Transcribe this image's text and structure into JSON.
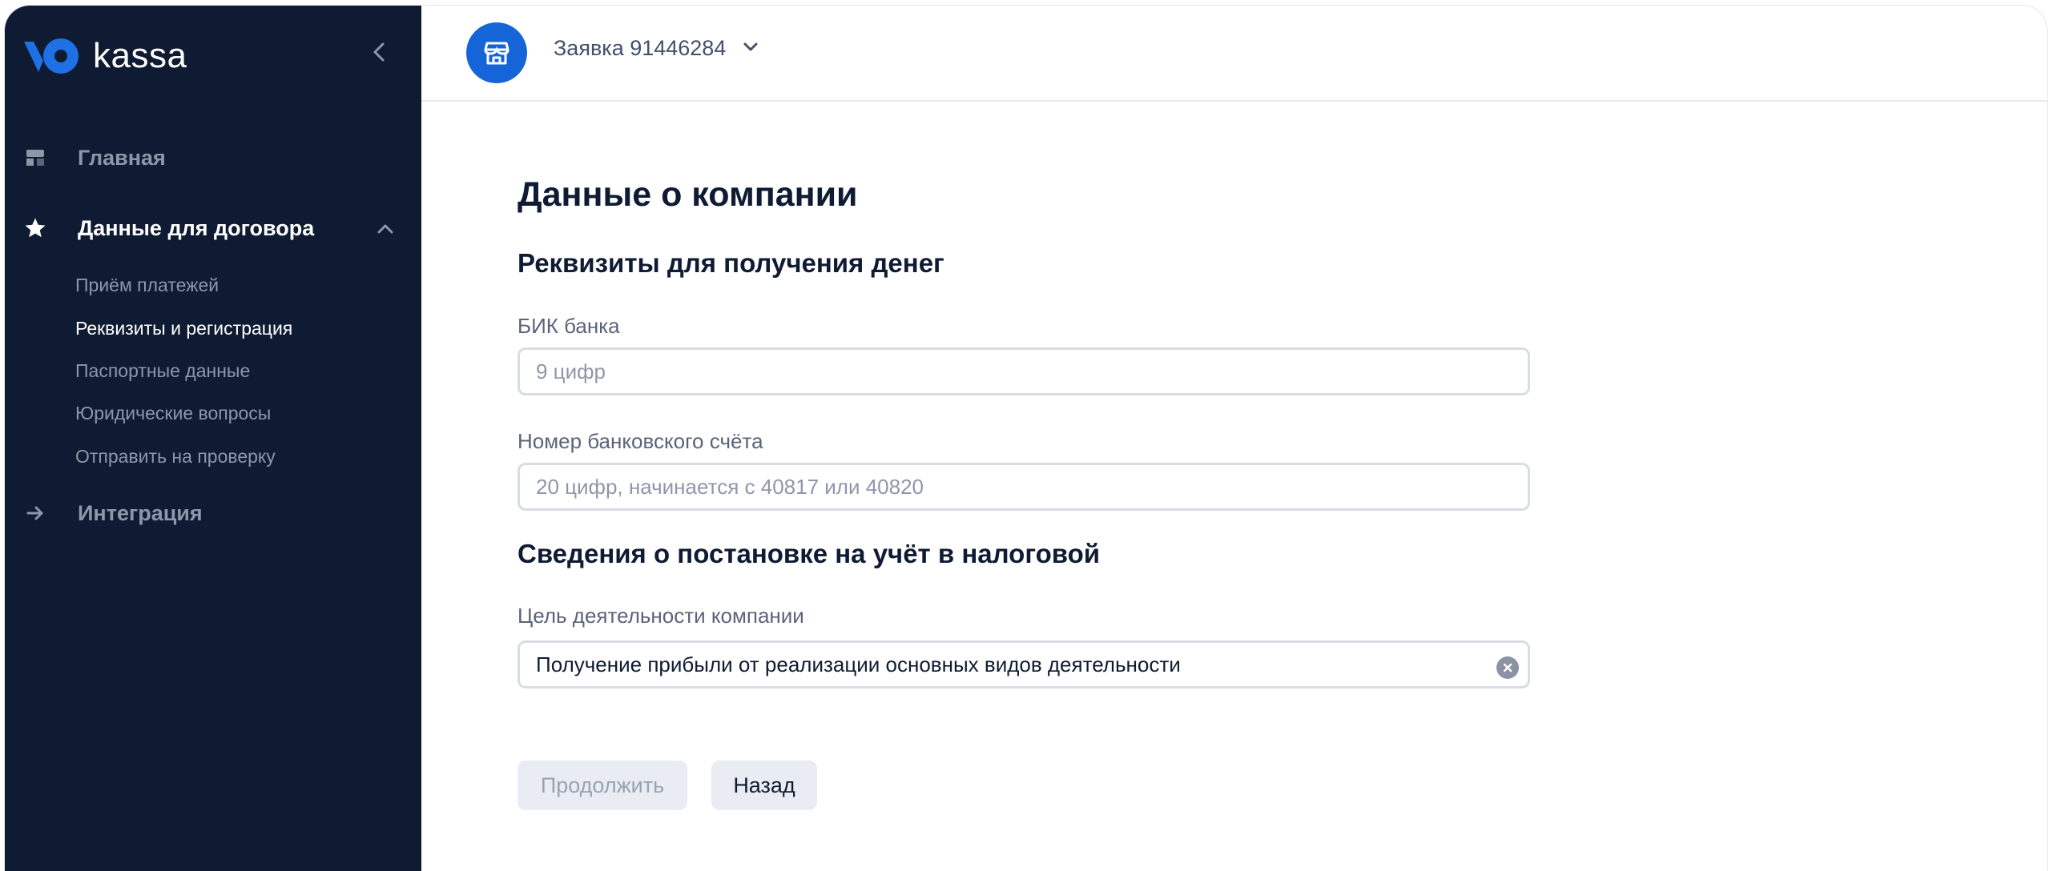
{
  "brand": {
    "name": "kassa"
  },
  "sidebar": {
    "collapse_icon": "chevron-left-icon",
    "items": [
      {
        "label": "Главная",
        "icon": "store-icon",
        "state": "inactive"
      },
      {
        "label": "Данные для договора",
        "icon": "star-icon",
        "state": "active",
        "expanded": true,
        "children": [
          {
            "label": "Приём платежей",
            "current": false
          },
          {
            "label": "Реквизиты и регистрация",
            "current": true
          },
          {
            "label": "Паспортные данные",
            "current": false
          },
          {
            "label": "Юридические вопросы",
            "current": false
          },
          {
            "label": "Отправить на проверку",
            "current": false
          }
        ]
      },
      {
        "label": "Интеграция",
        "icon": "arrow-right-icon",
        "state": "inactive"
      }
    ]
  },
  "topbar": {
    "application": "Заявка 91446284",
    "avatar_icon": "store-icon"
  },
  "main": {
    "title": "Данные о компании",
    "section_bank": "Реквизиты для получения денег",
    "bik": {
      "label": "БИК банка",
      "value": "",
      "placeholder": "9 цифр"
    },
    "account": {
      "label": "Номер банковского счёта",
      "value": "",
      "placeholder": "20 цифр, начинается с 40817 или 40820"
    },
    "section_tax": "Сведения о постановке на учёт в налоговой",
    "purpose": {
      "label": "Цель деятельности компании",
      "value": "Получение прибыли от реализации основных видов деятельности"
    },
    "buttons": {
      "continue": "Продолжить",
      "back": "Назад"
    }
  },
  "colors": {
    "sidebar_bg": "#0f1b33",
    "accent": "#1565d8",
    "text_primary": "#0f1b33",
    "text_muted": "#8e97a8",
    "button_bg": "#e9ecf2"
  }
}
